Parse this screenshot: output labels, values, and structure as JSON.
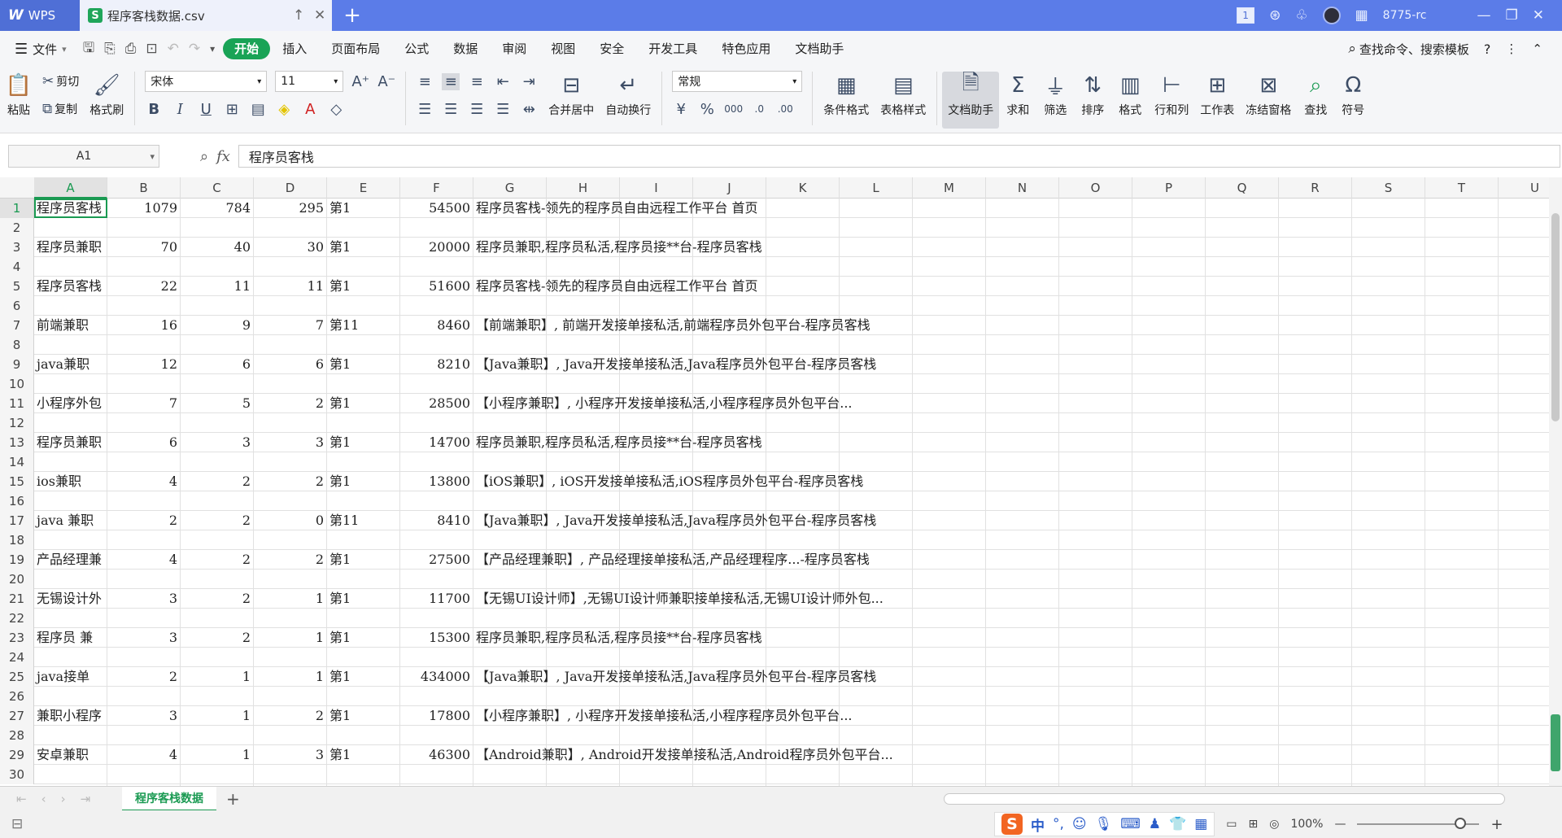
{
  "titlebar": {
    "app_tab": "WPS",
    "doc_tab": "程序客栈数据.csv",
    "badge": "1",
    "user": "8775-rc"
  },
  "menubar": {
    "file": "文件",
    "items": [
      "开始",
      "插入",
      "页面布局",
      "公式",
      "数据",
      "审阅",
      "视图",
      "安全",
      "开发工具",
      "特色应用",
      "文档助手"
    ],
    "active": "开始",
    "search": "查找命令、搜索模板"
  },
  "ribbon": {
    "paste": "粘贴",
    "cut": "剪切",
    "copy": "复制",
    "format_painter": "格式刷",
    "font_name": "宋体",
    "font_size": "11",
    "merge": "合并居中",
    "wrap": "自动换行",
    "number_format": "常规",
    "cond_format": "条件格式",
    "table_style": "表格样式",
    "doc_helper": "文档助手",
    "sum": "求和",
    "filter": "筛选",
    "sort": "排序",
    "format": "格式",
    "rowcol": "行和列",
    "sheet": "工作表",
    "freeze": "冻结窗格",
    "find": "查找",
    "symbol": "符号"
  },
  "formula": {
    "cell_ref": "A1",
    "fx": "fx",
    "value": "程序员客栈"
  },
  "columns": [
    "A",
    "B",
    "C",
    "D",
    "E",
    "F",
    "G",
    "H",
    "I",
    "J",
    "K",
    "L",
    "M",
    "N",
    "O",
    "P",
    "Q",
    "R",
    "S",
    "T",
    "U"
  ],
  "active_column": "A",
  "row_numbers": [
    "1",
    "2",
    "3",
    "4",
    "5",
    "6",
    "7",
    "8",
    "9",
    "10",
    "11",
    "12",
    "13",
    "14",
    "15",
    "16",
    "17",
    "18",
    "19",
    "20",
    "21",
    "22",
    "23",
    "24",
    "25",
    "26",
    "27",
    "28",
    "29",
    "30"
  ],
  "rows": [
    {
      "row": "1",
      "a": "程序员客栈",
      "b": "1079",
      "c": "784",
      "d": "295",
      "e": "第1",
      "f": "54500",
      "g": "程序员客栈-领先的程序员自由远程工作平台  首页"
    },
    {
      "row": "3",
      "a": "程序员兼职",
      "b": "70",
      "c": "40",
      "d": "30",
      "e": "第1",
      "f": "20000",
      "g": "程序员兼职,程序员私活,程序员接**台-程序员客栈"
    },
    {
      "row": "5",
      "a": "程序员客栈",
      "b": "22",
      "c": "11",
      "d": "11",
      "e": "第1",
      "f": "51600",
      "g": "程序员客栈-领先的程序员自由远程工作平台  首页"
    },
    {
      "row": "7",
      "a": "前端兼职",
      "b": "16",
      "c": "9",
      "d": "7",
      "e": "第11",
      "f": "8460",
      "g": "【前端兼职】, 前端开发接单接私活,前端程序员外包平台-程序员客栈"
    },
    {
      "row": "9",
      "a": "java兼职",
      "b": "12",
      "c": "6",
      "d": "6",
      "e": "第1",
      "f": "8210",
      "g": "【Java兼职】, Java开发接单接私活,Java程序员外包平台-程序员客栈"
    },
    {
      "row": "11",
      "a": "小程序外包",
      "b": "7",
      "c": "5",
      "d": "2",
      "e": "第1",
      "f": "28500",
      "g": "【小程序兼职】, 小程序开发接单接私活,小程序程序员外包平台..."
    },
    {
      "row": "13",
      "a": "程序员兼职",
      "b": "6",
      "c": "3",
      "d": "3",
      "e": "第1",
      "f": "14700",
      "g": "程序员兼职,程序员私活,程序员接**台-程序员客栈"
    },
    {
      "row": "15",
      "a": "ios兼职",
      "b": "4",
      "c": "2",
      "d": "2",
      "e": "第1",
      "f": "13800",
      "g": "【iOS兼职】, iOS开发接单接私活,iOS程序员外包平台-程序员客栈"
    },
    {
      "row": "17",
      "a": "java 兼职",
      "b": "2",
      "c": "2",
      "d": "0",
      "e": "第11",
      "f": "8410",
      "g": "【Java兼职】, Java开发接单接私活,Java程序员外包平台-程序员客栈"
    },
    {
      "row": "19",
      "a": "产品经理兼",
      "b": "4",
      "c": "2",
      "d": "2",
      "e": "第1",
      "f": "27500",
      "g": "【产品经理兼职】, 产品经理接单接私活,产品经理程序...-程序员客栈"
    },
    {
      "row": "21",
      "a": "无锡设计外",
      "b": "3",
      "c": "2",
      "d": "1",
      "e": "第1",
      "f": "11700",
      "g": "【无锡UI设计师】,无锡UI设计师兼职接单接私活,无锡UI设计师外包..."
    },
    {
      "row": "23",
      "a": "程序员 兼",
      "b": "3",
      "c": "2",
      "d": "1",
      "e": "第1",
      "f": "15300",
      "g": "程序员兼职,程序员私活,程序员接**台-程序员客栈"
    },
    {
      "row": "25",
      "a": "java接单",
      "b": "2",
      "c": "1",
      "d": "1",
      "e": "第1",
      "f": "434000",
      "g": "【Java兼职】, Java开发接单接私活,Java程序员外包平台-程序员客栈"
    },
    {
      "row": "27",
      "a": "兼职小程序",
      "b": "3",
      "c": "1",
      "d": "2",
      "e": "第1",
      "f": "17800",
      "g": "【小程序兼职】, 小程序开发接单接私活,小程序程序员外包平台..."
    },
    {
      "row": "29",
      "a": "安卓兼职",
      "b": "4",
      "c": "1",
      "d": "3",
      "e": "第1",
      "f": "46300",
      "g": "【Android兼职】, Android开发接单接私活,Android程序员外包平台..."
    }
  ],
  "sheet_tab": "程序客栈数据",
  "status": {
    "ime_lang": "中",
    "zoom": "100%"
  }
}
